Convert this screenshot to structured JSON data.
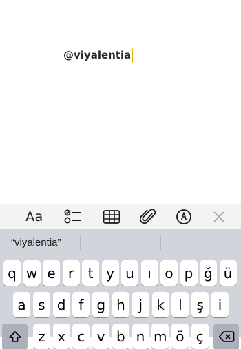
{
  "note": {
    "text": "@viyalentia",
    "caret_color": "#e5b400"
  },
  "toolbar": {
    "format_label": "Aa",
    "icons": [
      "checklist-icon",
      "table-icon",
      "paperclip-icon",
      "markup-pen-icon",
      "close-icon"
    ]
  },
  "keyboard": {
    "suggestion": "“viyalentia”",
    "row1": [
      "q",
      "w",
      "e",
      "r",
      "t",
      "y",
      "u",
      "ı",
      "o",
      "p",
      "ğ",
      "ü"
    ],
    "row2": [
      "a",
      "s",
      "d",
      "f",
      "g",
      "h",
      "j",
      "k",
      "l",
      "ş",
      "i"
    ],
    "row3": [
      "z",
      "x",
      "c",
      "v",
      "b",
      "n",
      "m",
      "ö",
      "ç"
    ]
  }
}
